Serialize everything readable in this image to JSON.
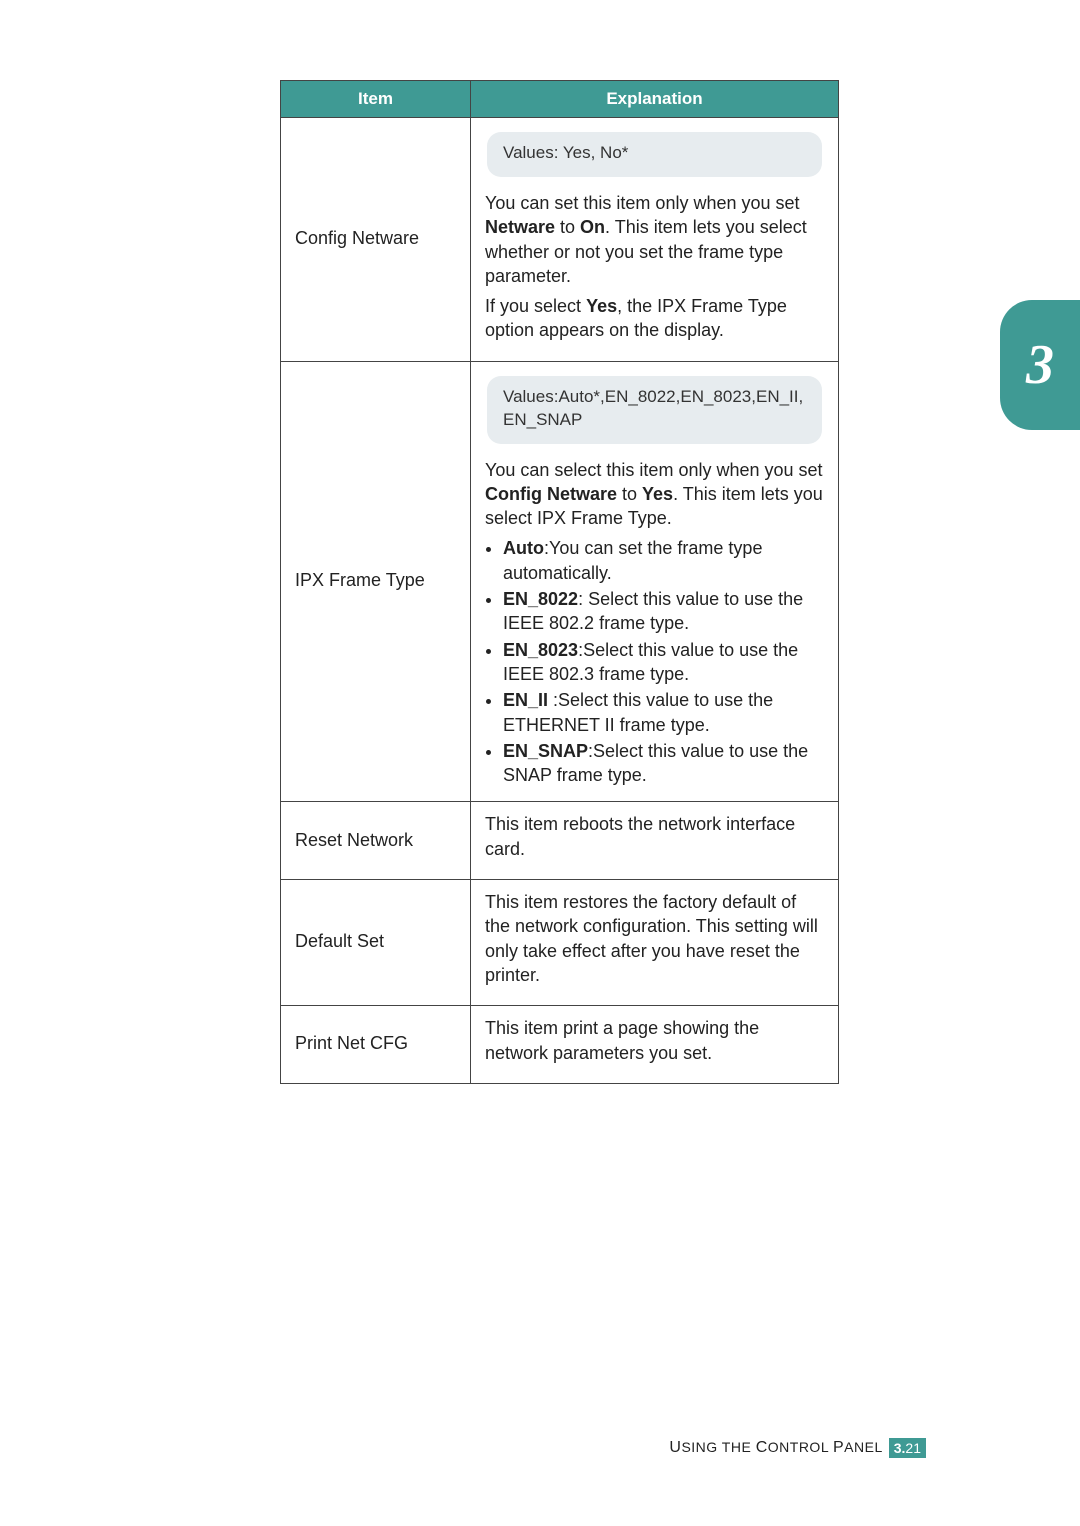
{
  "side_tab": {
    "number": "3"
  },
  "table": {
    "headers": {
      "item": "Item",
      "explanation": "Explanation"
    },
    "rows": [
      {
        "item": "Config Netware",
        "values_line": "Values: Yes, No*",
        "p1_pre": "You can set this item only when you set ",
        "p1_b1": "Netware",
        "p1_mid": " to ",
        "p1_b2": "On",
        "p1_post": ". This item lets you select whether or not you set the frame type parameter.",
        "p2_pre": "If you select ",
        "p2_b1": "Yes",
        "p2_post": ", the IPX Frame Type option appears on the display."
      },
      {
        "item": "IPX Frame Type",
        "values_line": "Values:Auto*,EN_8022,EN_8023,EN_II, EN_SNAP",
        "p1_pre": "You can select this item only when you set ",
        "p1_b1": "Config Netware",
        "p1_mid": " to ",
        "p1_b2": "Yes",
        "p1_post": ". This item lets you select IPX Frame Type.",
        "b_auto_label": "Auto",
        "b_auto_text": ":You can set the frame type automatically.",
        "b_8022_label": "EN_8022",
        "b_8022_text": ": Select this value to use the IEEE 802.2 frame type.",
        "b_8023_label": "EN_8023",
        "b_8023_text": ":Select this value to use the IEEE 802.3 frame type.",
        "b_ii_label": "EN_II",
        "b_ii_text": " :Select this value to use the ETHERNET II frame type.",
        "b_snap_label": "EN_SNAP",
        "b_snap_text": ":Select this value to use the SNAP frame type."
      },
      {
        "item": "Reset Network",
        "text": "This item reboots the network interface card."
      },
      {
        "item": "Default Set",
        "text": "This item restores the factory default of the network configuration. This setting will only take effect after you have reset the printer."
      },
      {
        "item": "Print Net CFG",
        "text": "This item print a page showing the network parameters you set."
      }
    ]
  },
  "footer": {
    "section_u": "U",
    "section_rest1": "SING THE ",
    "section_c": "C",
    "section_rest2": "ONTROL ",
    "section_p": "P",
    "section_rest3": "ANEL",
    "page_major": "3.",
    "page_minor": "21"
  }
}
